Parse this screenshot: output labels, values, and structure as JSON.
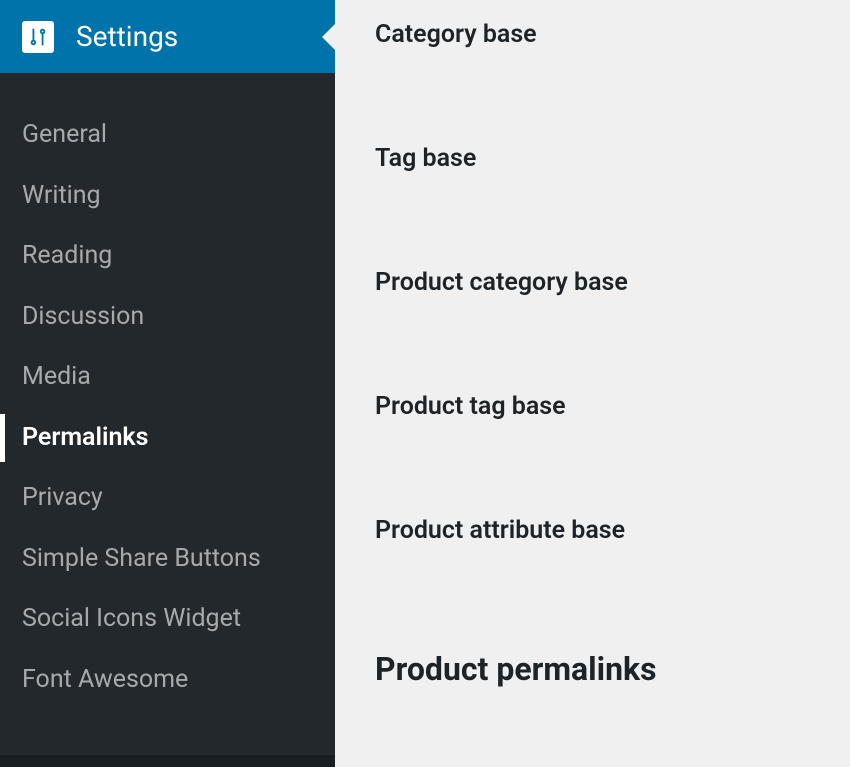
{
  "sidebar": {
    "header_label": "Settings",
    "items": [
      {
        "label": "General",
        "active": false
      },
      {
        "label": "Writing",
        "active": false
      },
      {
        "label": "Reading",
        "active": false
      },
      {
        "label": "Discussion",
        "active": false
      },
      {
        "label": "Media",
        "active": false
      },
      {
        "label": "Permalinks",
        "active": true
      },
      {
        "label": "Privacy",
        "active": false
      },
      {
        "label": "Simple Share Buttons",
        "active": false
      },
      {
        "label": "Social Icons Widget",
        "active": false
      },
      {
        "label": "Font Awesome",
        "active": false
      }
    ]
  },
  "content": {
    "fields": [
      {
        "label": "Category base"
      },
      {
        "label": "Tag base"
      },
      {
        "label": "Product category base"
      },
      {
        "label": "Product tag base"
      },
      {
        "label": "Product attribute base"
      }
    ],
    "section_heading": "Product permalinks"
  }
}
